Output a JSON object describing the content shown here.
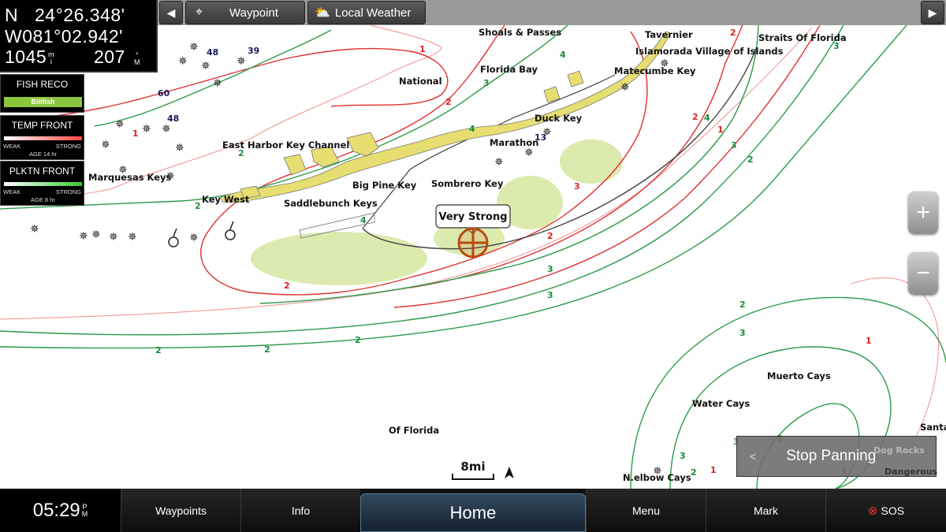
{
  "position": {
    "lat_hemisphere": "N",
    "latitude": "24°26.348'",
    "longitude": "W081°02.942'",
    "distance_value": "1045",
    "distance_unit_top": "m",
    "distance_unit_bottom": "i",
    "bearing_value": "207",
    "bearing_unit_top": "°",
    "bearing_unit_bottom": "M"
  },
  "toolbar": {
    "waypoint_label": "Waypoint",
    "weather_label": "Local Weather"
  },
  "overlays": {
    "fish": {
      "title": "FISH RECO",
      "value": "Billfish"
    },
    "temp": {
      "title": "TEMP FRONT",
      "weak": "WEAK",
      "strong": "STRONG",
      "age": "AGE 14 hr"
    },
    "plankton": {
      "title": "PLKTN FRONT",
      "weak": "WEAK",
      "strong": "STRONG",
      "age": "AGE 8 hr"
    }
  },
  "map": {
    "place_labels": {
      "shoals": "Shoals & Passes",
      "tavernier": "Tavernier",
      "straits": "Straits Of Florida",
      "islamorada": "Islamorada Village of Islands",
      "florida_bay": "Florida Bay",
      "national": "National",
      "matecumbe": "Matecumbe Key",
      "duck_key": "Duck Key",
      "marathon": "Marathon",
      "east_harbor": "East Harbor Key Channel",
      "marquesas": "Marquesas Keys",
      "big_pine": "Big Pine Key",
      "sombrero": "Sombrero Key",
      "key_west": "Key West",
      "saddlebunch": "Saddlebunch Keys",
      "muerto": "Muerto Cays",
      "water_cays": "Water Cays",
      "of_florida": "Of Florida",
      "dog_rocks": "Dog Rocks",
      "santa": "Santa",
      "dangerous": "Dangerous",
      "nelbow": "N.elbow Cays"
    },
    "callout": "Very Strong",
    "scale": "8mi",
    "soundings": [
      "48",
      "39",
      "60",
      "48",
      "13"
    ],
    "depth_labels_red": [
      "1",
      "2",
      "2",
      "1",
      "2",
      "1",
      "3",
      "2",
      "2",
      "1",
      "1",
      "1"
    ],
    "depth_labels_green": [
      "3",
      "3",
      "2",
      "4",
      "4",
      "3",
      "4",
      "2",
      "3",
      "2",
      "4",
      "3",
      "3",
      "2",
      "2",
      "2",
      "2",
      "3",
      "3",
      "2",
      "3",
      "3"
    ]
  },
  "zoom": {
    "in_label": "+",
    "out_label": "−"
  },
  "stop_panning_label": "Stop Panning",
  "bottom": {
    "time": "05:29",
    "time_ampm_top": "P",
    "time_ampm_bottom": "M",
    "waypoints": "Waypoints",
    "info": "Info",
    "home": "Home",
    "menu": "Menu",
    "mark": "Mark",
    "sos": "SOS"
  },
  "colors": {
    "fish_bar": "#8cc63f",
    "contour_red": "#e03030",
    "contour_green": "#2a9a4a",
    "land": "#e8e07a",
    "front_area": "#d8e8a0"
  }
}
